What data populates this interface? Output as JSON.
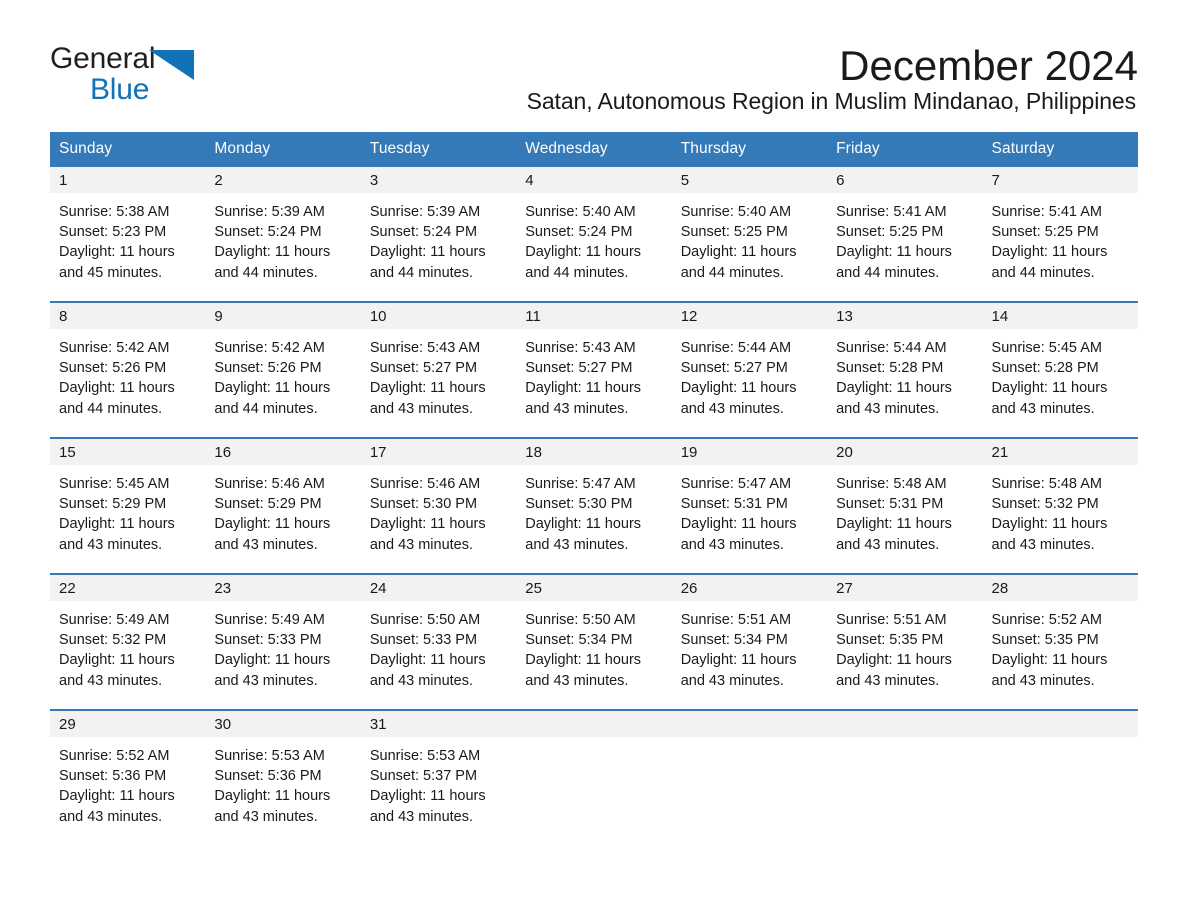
{
  "brand": {
    "name_part1": "General",
    "name_part2": "Blue"
  },
  "header": {
    "month_title": "December 2024",
    "subtitle": "Satan, Autonomous Region in Muslim Mindanao, Philippines"
  },
  "colors": {
    "header_blue": "#3479b8",
    "logo_blue": "#1272b8",
    "daynum_band": "#f2f2f2",
    "text": "#1a1a1a"
  },
  "calendar": {
    "weekday_headers": [
      "Sunday",
      "Monday",
      "Tuesday",
      "Wednesday",
      "Thursday",
      "Friday",
      "Saturday"
    ],
    "weeks": [
      [
        {
          "day": "1",
          "sunrise": "Sunrise: 5:38 AM",
          "sunset": "Sunset: 5:23 PM",
          "daylight_line1": "Daylight: 11 hours",
          "daylight_line2": "and 45 minutes."
        },
        {
          "day": "2",
          "sunrise": "Sunrise: 5:39 AM",
          "sunset": "Sunset: 5:24 PM",
          "daylight_line1": "Daylight: 11 hours",
          "daylight_line2": "and 44 minutes."
        },
        {
          "day": "3",
          "sunrise": "Sunrise: 5:39 AM",
          "sunset": "Sunset: 5:24 PM",
          "daylight_line1": "Daylight: 11 hours",
          "daylight_line2": "and 44 minutes."
        },
        {
          "day": "4",
          "sunrise": "Sunrise: 5:40 AM",
          "sunset": "Sunset: 5:24 PM",
          "daylight_line1": "Daylight: 11 hours",
          "daylight_line2": "and 44 minutes."
        },
        {
          "day": "5",
          "sunrise": "Sunrise: 5:40 AM",
          "sunset": "Sunset: 5:25 PM",
          "daylight_line1": "Daylight: 11 hours",
          "daylight_line2": "and 44 minutes."
        },
        {
          "day": "6",
          "sunrise": "Sunrise: 5:41 AM",
          "sunset": "Sunset: 5:25 PM",
          "daylight_line1": "Daylight: 11 hours",
          "daylight_line2": "and 44 minutes."
        },
        {
          "day": "7",
          "sunrise": "Sunrise: 5:41 AM",
          "sunset": "Sunset: 5:25 PM",
          "daylight_line1": "Daylight: 11 hours",
          "daylight_line2": "and 44 minutes."
        }
      ],
      [
        {
          "day": "8",
          "sunrise": "Sunrise: 5:42 AM",
          "sunset": "Sunset: 5:26 PM",
          "daylight_line1": "Daylight: 11 hours",
          "daylight_line2": "and 44 minutes."
        },
        {
          "day": "9",
          "sunrise": "Sunrise: 5:42 AM",
          "sunset": "Sunset: 5:26 PM",
          "daylight_line1": "Daylight: 11 hours",
          "daylight_line2": "and 44 minutes."
        },
        {
          "day": "10",
          "sunrise": "Sunrise: 5:43 AM",
          "sunset": "Sunset: 5:27 PM",
          "daylight_line1": "Daylight: 11 hours",
          "daylight_line2": "and 43 minutes."
        },
        {
          "day": "11",
          "sunrise": "Sunrise: 5:43 AM",
          "sunset": "Sunset: 5:27 PM",
          "daylight_line1": "Daylight: 11 hours",
          "daylight_line2": "and 43 minutes."
        },
        {
          "day": "12",
          "sunrise": "Sunrise: 5:44 AM",
          "sunset": "Sunset: 5:27 PM",
          "daylight_line1": "Daylight: 11 hours",
          "daylight_line2": "and 43 minutes."
        },
        {
          "day": "13",
          "sunrise": "Sunrise: 5:44 AM",
          "sunset": "Sunset: 5:28 PM",
          "daylight_line1": "Daylight: 11 hours",
          "daylight_line2": "and 43 minutes."
        },
        {
          "day": "14",
          "sunrise": "Sunrise: 5:45 AM",
          "sunset": "Sunset: 5:28 PM",
          "daylight_line1": "Daylight: 11 hours",
          "daylight_line2": "and 43 minutes."
        }
      ],
      [
        {
          "day": "15",
          "sunrise": "Sunrise: 5:45 AM",
          "sunset": "Sunset: 5:29 PM",
          "daylight_line1": "Daylight: 11 hours",
          "daylight_line2": "and 43 minutes."
        },
        {
          "day": "16",
          "sunrise": "Sunrise: 5:46 AM",
          "sunset": "Sunset: 5:29 PM",
          "daylight_line1": "Daylight: 11 hours",
          "daylight_line2": "and 43 minutes."
        },
        {
          "day": "17",
          "sunrise": "Sunrise: 5:46 AM",
          "sunset": "Sunset: 5:30 PM",
          "daylight_line1": "Daylight: 11 hours",
          "daylight_line2": "and 43 minutes."
        },
        {
          "day": "18",
          "sunrise": "Sunrise: 5:47 AM",
          "sunset": "Sunset: 5:30 PM",
          "daylight_line1": "Daylight: 11 hours",
          "daylight_line2": "and 43 minutes."
        },
        {
          "day": "19",
          "sunrise": "Sunrise: 5:47 AM",
          "sunset": "Sunset: 5:31 PM",
          "daylight_line1": "Daylight: 11 hours",
          "daylight_line2": "and 43 minutes."
        },
        {
          "day": "20",
          "sunrise": "Sunrise: 5:48 AM",
          "sunset": "Sunset: 5:31 PM",
          "daylight_line1": "Daylight: 11 hours",
          "daylight_line2": "and 43 minutes."
        },
        {
          "day": "21",
          "sunrise": "Sunrise: 5:48 AM",
          "sunset": "Sunset: 5:32 PM",
          "daylight_line1": "Daylight: 11 hours",
          "daylight_line2": "and 43 minutes."
        }
      ],
      [
        {
          "day": "22",
          "sunrise": "Sunrise: 5:49 AM",
          "sunset": "Sunset: 5:32 PM",
          "daylight_line1": "Daylight: 11 hours",
          "daylight_line2": "and 43 minutes."
        },
        {
          "day": "23",
          "sunrise": "Sunrise: 5:49 AM",
          "sunset": "Sunset: 5:33 PM",
          "daylight_line1": "Daylight: 11 hours",
          "daylight_line2": "and 43 minutes."
        },
        {
          "day": "24",
          "sunrise": "Sunrise: 5:50 AM",
          "sunset": "Sunset: 5:33 PM",
          "daylight_line1": "Daylight: 11 hours",
          "daylight_line2": "and 43 minutes."
        },
        {
          "day": "25",
          "sunrise": "Sunrise: 5:50 AM",
          "sunset": "Sunset: 5:34 PM",
          "daylight_line1": "Daylight: 11 hours",
          "daylight_line2": "and 43 minutes."
        },
        {
          "day": "26",
          "sunrise": "Sunrise: 5:51 AM",
          "sunset": "Sunset: 5:34 PM",
          "daylight_line1": "Daylight: 11 hours",
          "daylight_line2": "and 43 minutes."
        },
        {
          "day": "27",
          "sunrise": "Sunrise: 5:51 AM",
          "sunset": "Sunset: 5:35 PM",
          "daylight_line1": "Daylight: 11 hours",
          "daylight_line2": "and 43 minutes."
        },
        {
          "day": "28",
          "sunrise": "Sunrise: 5:52 AM",
          "sunset": "Sunset: 5:35 PM",
          "daylight_line1": "Daylight: 11 hours",
          "daylight_line2": "and 43 minutes."
        }
      ],
      [
        {
          "day": "29",
          "sunrise": "Sunrise: 5:52 AM",
          "sunset": "Sunset: 5:36 PM",
          "daylight_line1": "Daylight: 11 hours",
          "daylight_line2": "and 43 minutes."
        },
        {
          "day": "30",
          "sunrise": "Sunrise: 5:53 AM",
          "sunset": "Sunset: 5:36 PM",
          "daylight_line1": "Daylight: 11 hours",
          "daylight_line2": "and 43 minutes."
        },
        {
          "day": "31",
          "sunrise": "Sunrise: 5:53 AM",
          "sunset": "Sunset: 5:37 PM",
          "daylight_line1": "Daylight: 11 hours",
          "daylight_line2": "and 43 minutes."
        },
        {
          "day": "",
          "sunrise": "",
          "sunset": "",
          "daylight_line1": "",
          "daylight_line2": ""
        },
        {
          "day": "",
          "sunrise": "",
          "sunset": "",
          "daylight_line1": "",
          "daylight_line2": ""
        },
        {
          "day": "",
          "sunrise": "",
          "sunset": "",
          "daylight_line1": "",
          "daylight_line2": ""
        },
        {
          "day": "",
          "sunrise": "",
          "sunset": "",
          "daylight_line1": "",
          "daylight_line2": ""
        }
      ]
    ]
  }
}
